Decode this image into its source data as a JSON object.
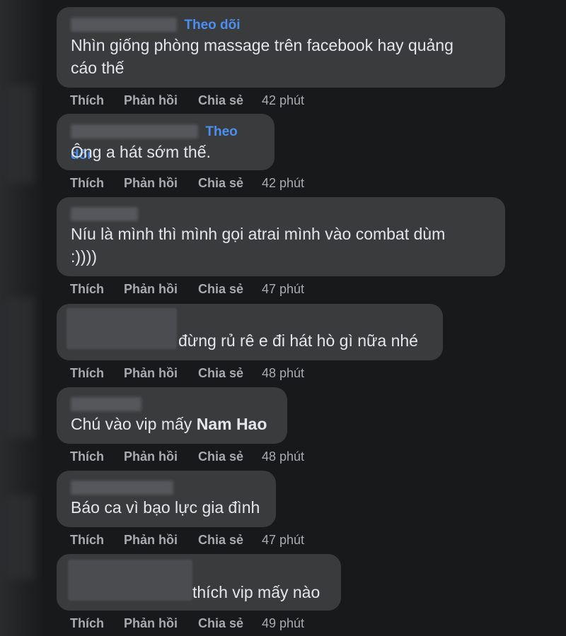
{
  "actions": {
    "like": "Thích",
    "reply": "Phản hồi",
    "share": "Chia sẻ"
  },
  "follow_label": "Theo dõi",
  "comments": [
    {
      "text_line1": "Nhìn giống phòng massage trên facebook hay quảng",
      "text_line2": "cáo thế",
      "time": "42 phút"
    },
    {
      "text": "Ông a hát sớm thế.",
      "time": "42 phút"
    },
    {
      "text_line1": "Níu là mình thì mình gọi atrai mình vào combat dùm",
      "text_line2": ":))))",
      "time": "47 phút"
    },
    {
      "text": "đừng rủ rê e đi hát hò gì nữa nhé",
      "time": "48 phút"
    },
    {
      "text_prefix": "Chú vào vip mấy ",
      "mention": "Nam Hao",
      "time": "48 phút"
    },
    {
      "text": "Báo ca vì bạo lực gia đình",
      "time": "47 phút"
    },
    {
      "text": "thích vip mấy nào",
      "time": "49 phút"
    }
  ],
  "colors": {
    "background": "#18191a",
    "bubble": "#3a3b3c",
    "text": "#e4e6eb",
    "secondary_text": "#a8abaf",
    "follow_link": "#4b8ff0"
  }
}
